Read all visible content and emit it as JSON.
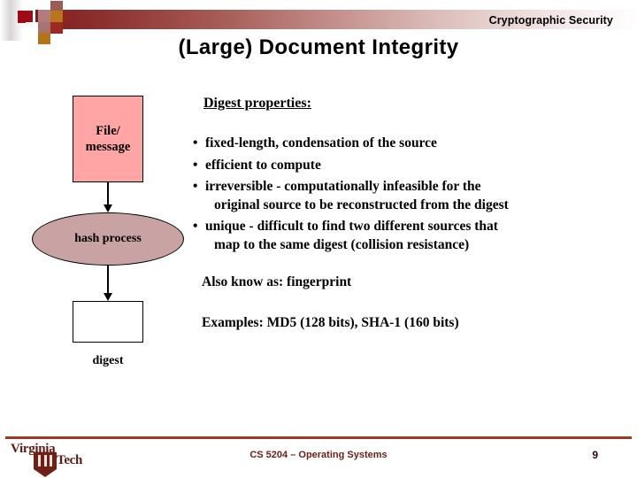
{
  "header": {
    "section_label": "Cryptographic Security",
    "accent_dark": "#7d1c1c",
    "accent_red": "#9e0b14",
    "accent_orange": "#b8771c"
  },
  "slide": {
    "title": "(Large) Document Integrity"
  },
  "diagram": {
    "file_box": {
      "line1": "File/",
      "line2": "message",
      "fill": "#ffa5a5"
    },
    "hash_ellipse": {
      "label": "hash process",
      "fill": "#c9a3a3"
    },
    "digest_box": {
      "fill": "#ffffff"
    },
    "digest_label": "digest"
  },
  "content": {
    "heading": "Digest properties:",
    "bullets": [
      {
        "line1": "fixed-length, condensation of the source",
        "line2": ""
      },
      {
        "line1": "efficient to compute",
        "line2": ""
      },
      {
        "line1": "irreversible - computationally infeasible for the",
        "line2": "original source to be reconstructed from the digest"
      },
      {
        "line1": "unique - difficult to find two different sources that",
        "line2": "map to the same digest (collision resistance)"
      }
    ],
    "bullet_glyph": "•",
    "also_known": "Also know as: fingerprint",
    "examples": "Examples: MD5 (128 bits), SHA-1 (160 bits)"
  },
  "footer": {
    "logo_line1": "Virginia",
    "logo_line2": "Tech",
    "course": "CS 5204 – Operating Systems",
    "page_number": "9",
    "rule_color": "#9f3a21",
    "text_color": "#6e2018"
  }
}
